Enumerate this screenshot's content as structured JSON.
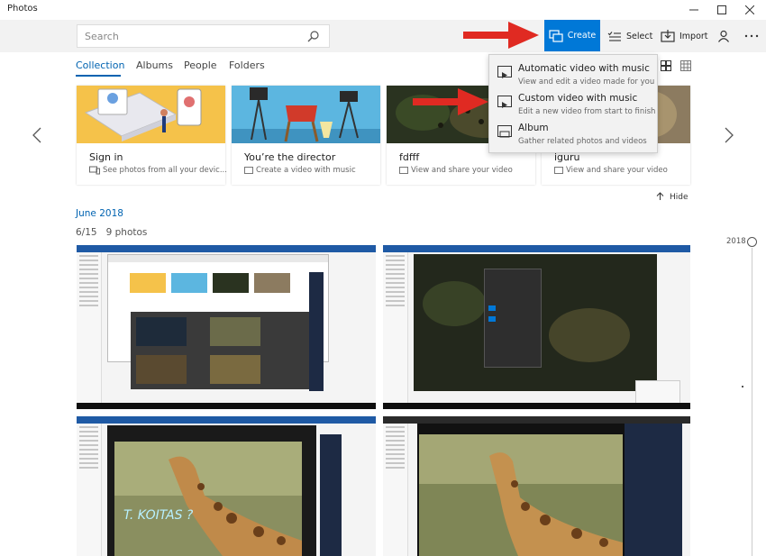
{
  "app": {
    "title": "Photos"
  },
  "search": {
    "placeholder": "Search"
  },
  "toolbar": {
    "create_label": "Create",
    "select_label": "Select",
    "import_label": "Import"
  },
  "tabs": [
    "Collection",
    "Albums",
    "People",
    "Folders"
  ],
  "active_tab": "Collection",
  "cards": [
    {
      "title": "Sign in",
      "subtitle": "See photos from all your devic..."
    },
    {
      "title": "You’re the director",
      "subtitle": "Create a video with music"
    },
    {
      "title": "fdfff",
      "subtitle": "View and share your video"
    },
    {
      "title": "iguru",
      "subtitle": "View and share your video"
    }
  ],
  "create_menu": [
    {
      "label": "Automatic video with music",
      "description": "View and edit a video made for you"
    },
    {
      "label": "Custom video with music",
      "description": "Edit a new video from start to finish"
    },
    {
      "label": "Album",
      "description": "Gather related photos and videos"
    }
  ],
  "hide_label": "Hide",
  "section": {
    "month": "June 2018",
    "date": "6/15",
    "count": "9 photos"
  },
  "timeline": {
    "year": "2018"
  },
  "photo_texts": {
    "handwriting": "T. KOITAS ?"
  },
  "colors": {
    "accent": "#0078d7",
    "link": "#0063b1",
    "arrow": "#e02a22",
    "menu_bg": "#f2f2f2",
    "toolbar_bg": "#f2f2f2"
  },
  "icons": [
    "search-icon",
    "create-icon",
    "select-icon",
    "import-icon",
    "person-icon",
    "more-icon",
    "grid-icon",
    "chevron-left-icon",
    "chevron-right-icon",
    "arrow-up-icon"
  ]
}
